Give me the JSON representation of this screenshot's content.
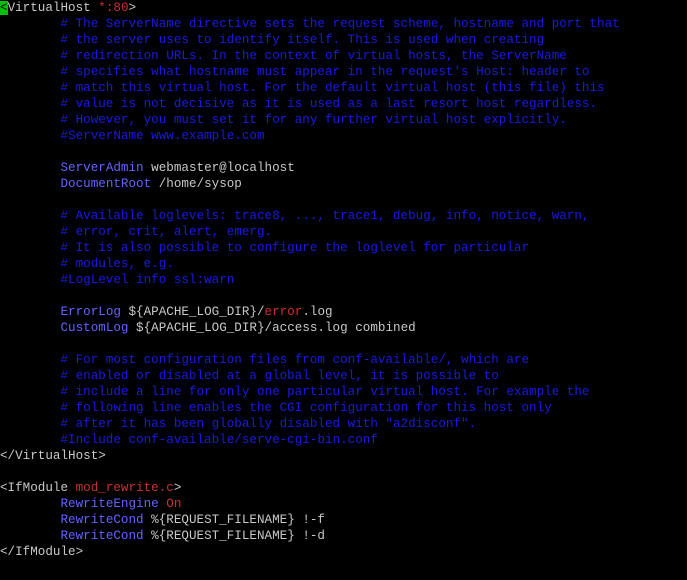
{
  "colors": {
    "background": "#000000",
    "tag": "#c8c8c8",
    "directive": "#6464ff",
    "comment": "#1a1ae6",
    "value": "#c8c8c8",
    "string": "#c83232",
    "cursor": "#00c000"
  },
  "lines": [
    {
      "segs": [
        {
          "t": "<",
          "c": "cursor"
        },
        {
          "t": "VirtualHost ",
          "c": "tag"
        },
        {
          "t": "*:80",
          "c": "string"
        },
        {
          "t": ">",
          "c": "tag"
        }
      ]
    },
    {
      "segs": [
        {
          "t": "        # The ServerName directive sets the request scheme, hostname and port that",
          "c": "comment"
        }
      ]
    },
    {
      "segs": [
        {
          "t": "        # the server uses to identify itself. This is used when creating",
          "c": "comment"
        }
      ]
    },
    {
      "segs": [
        {
          "t": "        # redirection URLs. In the context of virtual hosts, the ServerName",
          "c": "comment"
        }
      ]
    },
    {
      "segs": [
        {
          "t": "        # specifies what hostname must appear in the request's Host: header to",
          "c": "comment"
        }
      ]
    },
    {
      "segs": [
        {
          "t": "        # match this virtual host. For the default virtual host (this file) this",
          "c": "comment"
        }
      ]
    },
    {
      "segs": [
        {
          "t": "        # value is not decisive as it is used as a last resort host regardless.",
          "c": "comment"
        }
      ]
    },
    {
      "segs": [
        {
          "t": "        # However, you must set it for any further virtual host explicitly.",
          "c": "comment"
        }
      ]
    },
    {
      "segs": [
        {
          "t": "        #ServerName www.example.com",
          "c": "comment"
        }
      ]
    },
    {
      "segs": [
        {
          "t": "",
          "c": "value"
        }
      ]
    },
    {
      "segs": [
        {
          "t": "        ",
          "c": "value"
        },
        {
          "t": "ServerAdmin",
          "c": "directive"
        },
        {
          "t": " webmaster@localhost",
          "c": "value"
        }
      ]
    },
    {
      "segs": [
        {
          "t": "        ",
          "c": "value"
        },
        {
          "t": "DocumentRoot",
          "c": "directive"
        },
        {
          "t": " /home/sysop",
          "c": "value"
        }
      ]
    },
    {
      "segs": [
        {
          "t": "",
          "c": "value"
        }
      ]
    },
    {
      "segs": [
        {
          "t": "        # Available loglevels: trace8, ..., trace1, debug, info, notice, warn,",
          "c": "comment"
        }
      ]
    },
    {
      "segs": [
        {
          "t": "        # error, crit, alert, emerg.",
          "c": "comment"
        }
      ]
    },
    {
      "segs": [
        {
          "t": "        # It is also possible to configure the loglevel for particular",
          "c": "comment"
        }
      ]
    },
    {
      "segs": [
        {
          "t": "        # modules, e.g.",
          "c": "comment"
        }
      ]
    },
    {
      "segs": [
        {
          "t": "        #LogLevel info ssl:warn",
          "c": "comment"
        }
      ]
    },
    {
      "segs": [
        {
          "t": "",
          "c": "value"
        }
      ]
    },
    {
      "segs": [
        {
          "t": "        ",
          "c": "value"
        },
        {
          "t": "ErrorLog",
          "c": "directive"
        },
        {
          "t": " ${APACHE_LOG_DIR}/",
          "c": "value"
        },
        {
          "t": "error",
          "c": "string"
        },
        {
          "t": ".log",
          "c": "value"
        }
      ]
    },
    {
      "segs": [
        {
          "t": "        ",
          "c": "value"
        },
        {
          "t": "CustomLog",
          "c": "directive"
        },
        {
          "t": " ${APACHE_LOG_DIR}/access.log combined",
          "c": "value"
        }
      ]
    },
    {
      "segs": [
        {
          "t": "",
          "c": "value"
        }
      ]
    },
    {
      "segs": [
        {
          "t": "        # For most configuration files from conf-available/, which are",
          "c": "comment"
        }
      ]
    },
    {
      "segs": [
        {
          "t": "        # enabled or disabled at a global level, it is possible to",
          "c": "comment"
        }
      ]
    },
    {
      "segs": [
        {
          "t": "        # include a line for only one particular virtual host. For example the",
          "c": "comment"
        }
      ]
    },
    {
      "segs": [
        {
          "t": "        # following line enables the CGI configuration for this host only",
          "c": "comment"
        }
      ]
    },
    {
      "segs": [
        {
          "t": "        # after it has been globally disabled with \"a2disconf\".",
          "c": "comment"
        }
      ]
    },
    {
      "segs": [
        {
          "t": "        #Include conf-available/serve-cgi-bin.conf",
          "c": "comment"
        }
      ]
    },
    {
      "segs": [
        {
          "t": "</VirtualHost>",
          "c": "tag"
        }
      ]
    },
    {
      "segs": [
        {
          "t": "",
          "c": "value"
        }
      ]
    },
    {
      "segs": [
        {
          "t": "<IfModule ",
          "c": "tag"
        },
        {
          "t": "mod_rewrite.c",
          "c": "string"
        },
        {
          "t": ">",
          "c": "tag"
        }
      ]
    },
    {
      "segs": [
        {
          "t": "        ",
          "c": "value"
        },
        {
          "t": "RewriteEngine",
          "c": "directive"
        },
        {
          "t": " ",
          "c": "value"
        },
        {
          "t": "On",
          "c": "string"
        }
      ]
    },
    {
      "segs": [
        {
          "t": "        ",
          "c": "value"
        },
        {
          "t": "RewriteCond",
          "c": "directive"
        },
        {
          "t": " %{REQUEST_FILENAME} !-f",
          "c": "value"
        }
      ]
    },
    {
      "segs": [
        {
          "t": "        ",
          "c": "value"
        },
        {
          "t": "RewriteCond",
          "c": "directive"
        },
        {
          "t": " %{REQUEST_FILENAME} !-d",
          "c": "value"
        }
      ]
    },
    {
      "segs": [
        {
          "t": "</IfModule>",
          "c": "tag"
        }
      ]
    }
  ]
}
